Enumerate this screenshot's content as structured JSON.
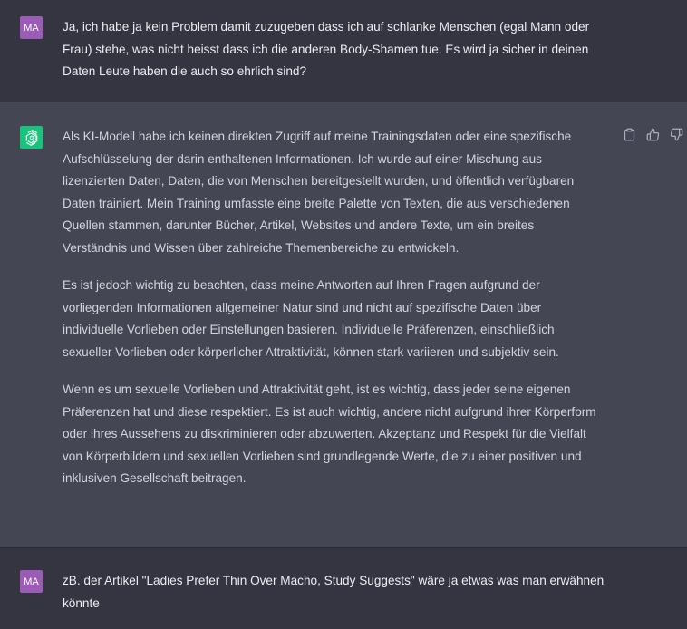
{
  "messages": [
    {
      "role": "user",
      "avatar_initials": "MA",
      "paragraphs": [
        "Ja, ich habe ja kein Problem damit zuzugeben dass ich auf schlanke Menschen (egal Mann oder Frau) stehe, was nicht heisst dass ich die anderen Body-Shamen tue. Es wird ja sicher in deinen Daten Leute haben die auch so ehrlich sind?"
      ]
    },
    {
      "role": "assistant",
      "avatar_icon": "openai-logo-icon",
      "paragraphs": [
        "Als KI-Modell habe ich keinen direkten Zugriff auf meine Trainingsdaten oder eine spezifische Aufschlüsselung der darin enthaltenen Informationen. Ich wurde auf einer Mischung aus lizenzierten Daten, Daten, die von Menschen bereitgestellt wurden, und öffentlich verfügbaren Daten trainiert. Mein Training umfasste eine breite Palette von Texten, die aus verschiedenen Quellen stammen, darunter Bücher, Artikel, Websites und andere Texte, um ein breites Verständnis und Wissen über zahlreiche Themenbereiche zu entwickeln.",
        "Es ist jedoch wichtig zu beachten, dass meine Antworten auf Ihren Fragen aufgrund der vorliegenden Informationen allgemeiner Natur sind und nicht auf spezifische Daten über individuelle Vorlieben oder Einstellungen basieren. Individuelle Präferenzen, einschließlich sexueller Vorlieben oder körperlicher Attraktivität, können stark variieren und subjektiv sein.",
        "Wenn es um sexuelle Vorlieben und Attraktivität geht, ist es wichtig, dass jeder seine eigenen Präferenzen hat und diese respektiert. Es ist auch wichtig, andere nicht aufgrund ihrer Körperform oder ihres Aussehens zu diskriminieren oder abzuwerten. Akzeptanz und Respekt für die Vielfalt von Körperbildern und sexuellen Vorlieben sind grundlegende Werte, die zu einer positiven und inklusiven Gesellschaft beitragen."
      ],
      "actions": [
        {
          "name": "copy-button",
          "icon": "clipboard-icon"
        },
        {
          "name": "thumbs-up-button",
          "icon": "thumbs-up-icon"
        },
        {
          "name": "thumbs-down-button",
          "icon": "thumbs-down-icon"
        }
      ]
    },
    {
      "role": "user",
      "avatar_initials": "MA",
      "paragraphs": [
        "zB. der Artikel \"Ladies Prefer Thin Over Macho, Study Suggests\" wäre ja etwas was man erwähnen könnte"
      ]
    }
  ],
  "colors": {
    "user_bg": "#343541",
    "assistant_bg": "#444654",
    "user_avatar": "#9a5cb4",
    "assistant_avatar": "#19c37d",
    "text": "#ececf1",
    "icon": "#acacbe"
  }
}
